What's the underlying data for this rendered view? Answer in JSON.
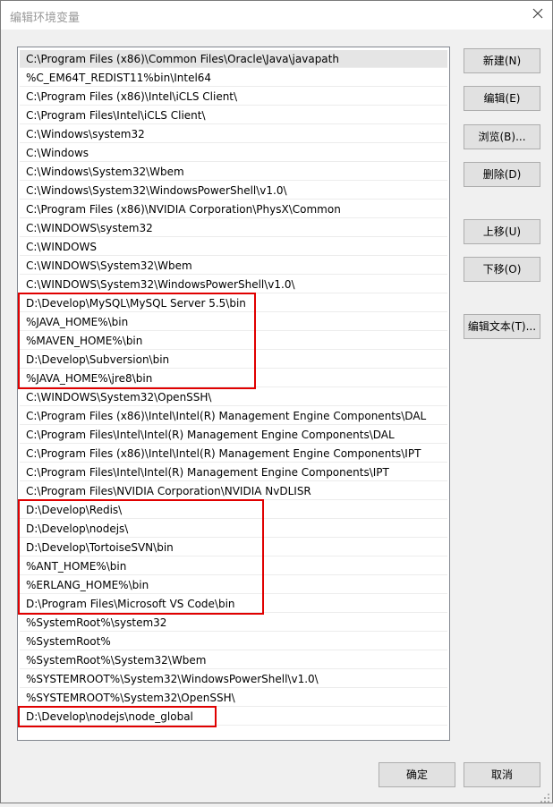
{
  "window": {
    "title": "编辑环境变量"
  },
  "paths": [
    "C:\\Program Files (x86)\\Common Files\\Oracle\\Java\\javapath",
    "%C_EM64T_REDIST11%bin\\Intel64",
    "C:\\Program Files (x86)\\Intel\\iCLS Client\\",
    "C:\\Program Files\\Intel\\iCLS Client\\",
    "C:\\Windows\\system32",
    "C:\\Windows",
    "C:\\Windows\\System32\\Wbem",
    "C:\\Windows\\System32\\WindowsPowerShell\\v1.0\\",
    "C:\\Program Files (x86)\\NVIDIA Corporation\\PhysX\\Common",
    "C:\\WINDOWS\\system32",
    "C:\\WINDOWS",
    "C:\\WINDOWS\\System32\\Wbem",
    "C:\\WINDOWS\\System32\\WindowsPowerShell\\v1.0\\",
    "D:\\Develop\\MySQL\\MySQL Server 5.5\\bin",
    "%JAVA_HOME%\\bin",
    "%MAVEN_HOME%\\bin",
    "D:\\Develop\\Subversion\\bin",
    "%JAVA_HOME%\\jre8\\bin",
    "C:\\WINDOWS\\System32\\OpenSSH\\",
    "C:\\Program Files (x86)\\Intel\\Intel(R) Management Engine Components\\DAL",
    "C:\\Program Files\\Intel\\Intel(R) Management Engine Components\\DAL",
    "C:\\Program Files (x86)\\Intel\\Intel(R) Management Engine Components\\IPT",
    "C:\\Program Files\\Intel\\Intel(R) Management Engine Components\\IPT",
    "C:\\Program Files\\NVIDIA Corporation\\NVIDIA NvDLISR",
    "D:\\Develop\\Redis\\",
    "D:\\Develop\\nodejs\\",
    "D:\\Develop\\TortoiseSVN\\bin",
    "%ANT_HOME%\\bin",
    "%ERLANG_HOME%\\bin",
    "D:\\Program Files\\Microsoft VS Code\\bin",
    "%SystemRoot%\\system32",
    "%SystemRoot%",
    "%SystemRoot%\\System32\\Wbem",
    "%SYSTEMROOT%\\System32\\WindowsPowerShell\\v1.0\\",
    "%SYSTEMROOT%\\System32\\OpenSSH\\",
    "D:\\Develop\\nodejs\\node_global"
  ],
  "selected_index": 0,
  "highlight_groups": [
    [
      13,
      17
    ],
    [
      24,
      29
    ],
    [
      35,
      35
    ]
  ],
  "highlight_color": "#e00000",
  "buttons": {
    "new": "新建(N)",
    "edit": "编辑(E)",
    "browse": "浏览(B)...",
    "delete": "删除(D)",
    "move_up": "上移(U)",
    "move_down": "下移(O)",
    "edit_text": "编辑文本(T)...",
    "ok": "确定",
    "cancel": "取消"
  },
  "icons": {
    "close": "close-icon",
    "resize": "resize-grip-icon"
  }
}
